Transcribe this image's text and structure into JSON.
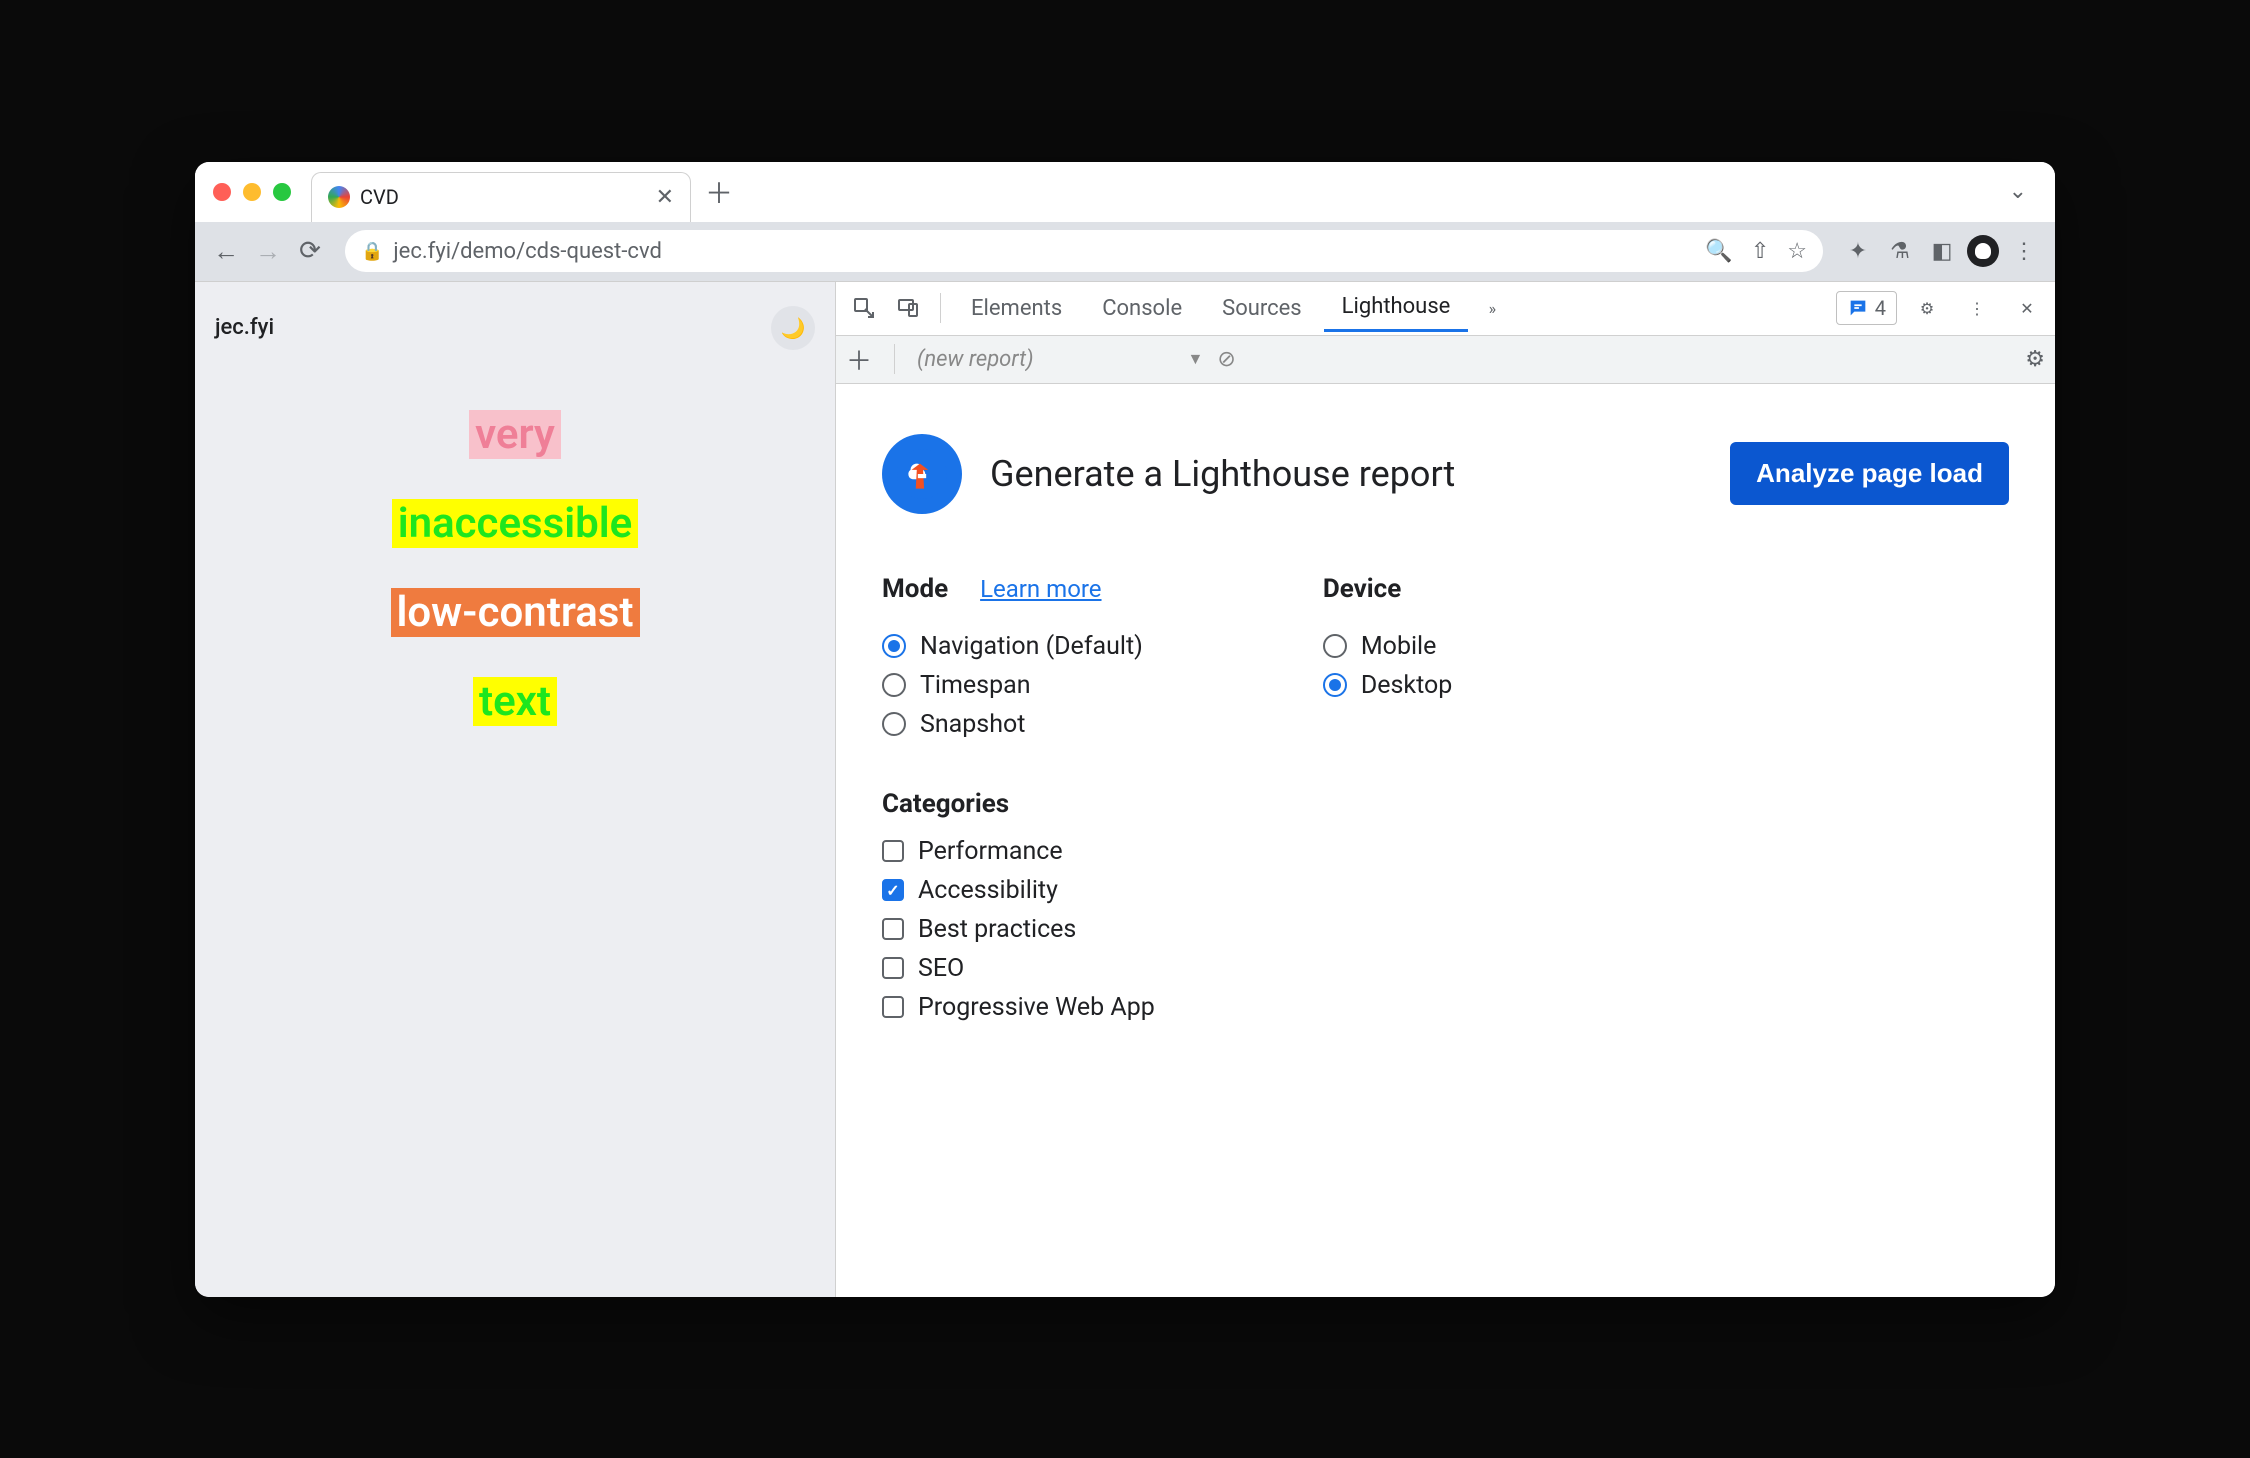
{
  "browser": {
    "tab_title": "CVD",
    "url": "jec.fyi/demo/cds-quest-cvd"
  },
  "page": {
    "brand": "jec.fyi",
    "words": [
      "very",
      "inaccessible",
      "low-contrast",
      "text"
    ]
  },
  "devtools": {
    "tabs": [
      "Elements",
      "Console",
      "Sources",
      "Lighthouse"
    ],
    "active_tab": "Lighthouse",
    "issues_count": "4",
    "report_dropdown": "(new report)"
  },
  "lighthouse": {
    "title": "Generate a Lighthouse report",
    "analyze_button": "Analyze page load",
    "mode": {
      "heading": "Mode",
      "learn_more": "Learn more",
      "options": [
        {
          "label": "Navigation (Default)",
          "checked": true
        },
        {
          "label": "Timespan",
          "checked": false
        },
        {
          "label": "Snapshot",
          "checked": false
        }
      ]
    },
    "device": {
      "heading": "Device",
      "options": [
        {
          "label": "Mobile",
          "checked": false
        },
        {
          "label": "Desktop",
          "checked": true
        }
      ]
    },
    "categories": {
      "heading": "Categories",
      "options": [
        {
          "label": "Performance",
          "checked": false
        },
        {
          "label": "Accessibility",
          "checked": true
        },
        {
          "label": "Best practices",
          "checked": false
        },
        {
          "label": "SEO",
          "checked": false
        },
        {
          "label": "Progressive Web App",
          "checked": false
        }
      ]
    }
  }
}
